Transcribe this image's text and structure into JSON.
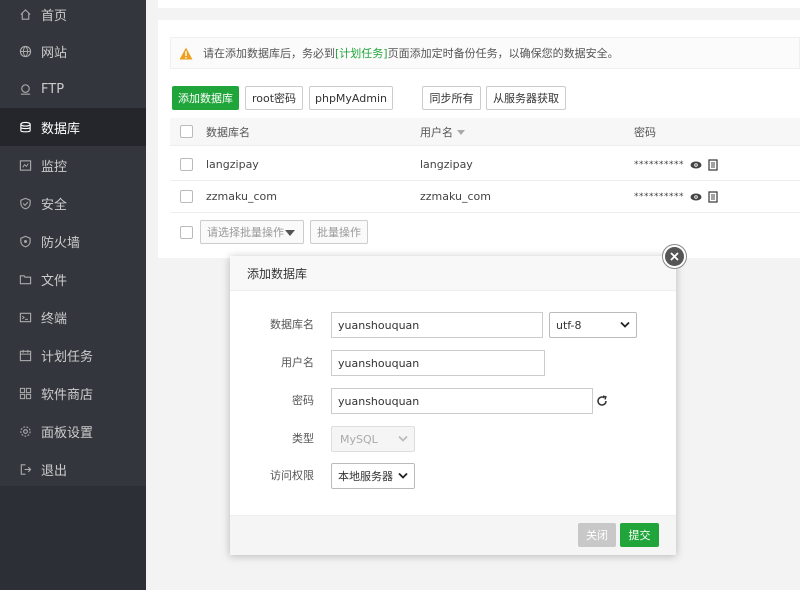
{
  "sidebar": {
    "items": [
      {
        "label": "首页",
        "icon": "home-icon"
      },
      {
        "label": "网站",
        "icon": "globe-icon"
      },
      {
        "label": "FTP",
        "icon": "ftp-icon"
      },
      {
        "label": "数据库",
        "icon": "database-icon",
        "active": true
      },
      {
        "label": "监控",
        "icon": "monitor-icon"
      },
      {
        "label": "安全",
        "icon": "shield-icon"
      },
      {
        "label": "防火墙",
        "icon": "firewall-icon"
      },
      {
        "label": "文件",
        "icon": "folder-icon"
      },
      {
        "label": "终端",
        "icon": "terminal-icon"
      },
      {
        "label": "计划任务",
        "icon": "calendar-icon"
      },
      {
        "label": "软件商店",
        "icon": "apps-icon"
      },
      {
        "label": "面板设置",
        "icon": "gear-icon"
      },
      {
        "label": "退出",
        "icon": "logout-icon"
      }
    ]
  },
  "alert": {
    "prefix": "请在添加数据库后，务必到",
    "link": "[计划任务]",
    "suffix": "页面添加定时备份任务，以确保您的数据安全。"
  },
  "toolbar": {
    "add_db": "添加数据库",
    "root_pwd": "root密码",
    "phpmyadmin": "phpMyAdmin",
    "sync_all": "同步所有",
    "fetch_server": "从服务器获取"
  },
  "table": {
    "headers": {
      "name": "数据库名",
      "user": "用户名",
      "password": "密码"
    },
    "rows": [
      {
        "name": "langzipay",
        "user": "langzipay",
        "password": "**********"
      },
      {
        "name": "zzmaku_com",
        "user": "zzmaku_com",
        "password": "**********"
      }
    ]
  },
  "batch": {
    "select_placeholder": "请选择批量操作",
    "button": "批量操作"
  },
  "modal": {
    "title": "添加数据库",
    "fields": {
      "db_name_label": "数据库名",
      "db_name_value": "yuanshouquan",
      "charset_value": "utf-8",
      "username_label": "用户名",
      "username_value": "yuanshouquan",
      "password_label": "密码",
      "password_value": "yuanshouquan",
      "type_label": "类型",
      "type_value": "MySQL",
      "access_label": "访问权限",
      "access_value": "本地服务器"
    },
    "close_label": "关闭",
    "submit_label": "提交"
  },
  "colors": {
    "accent": "#20a53a",
    "sidebar_bg": "#33363d",
    "sidebar_active": "#24262b",
    "warning": "#f0a020"
  }
}
